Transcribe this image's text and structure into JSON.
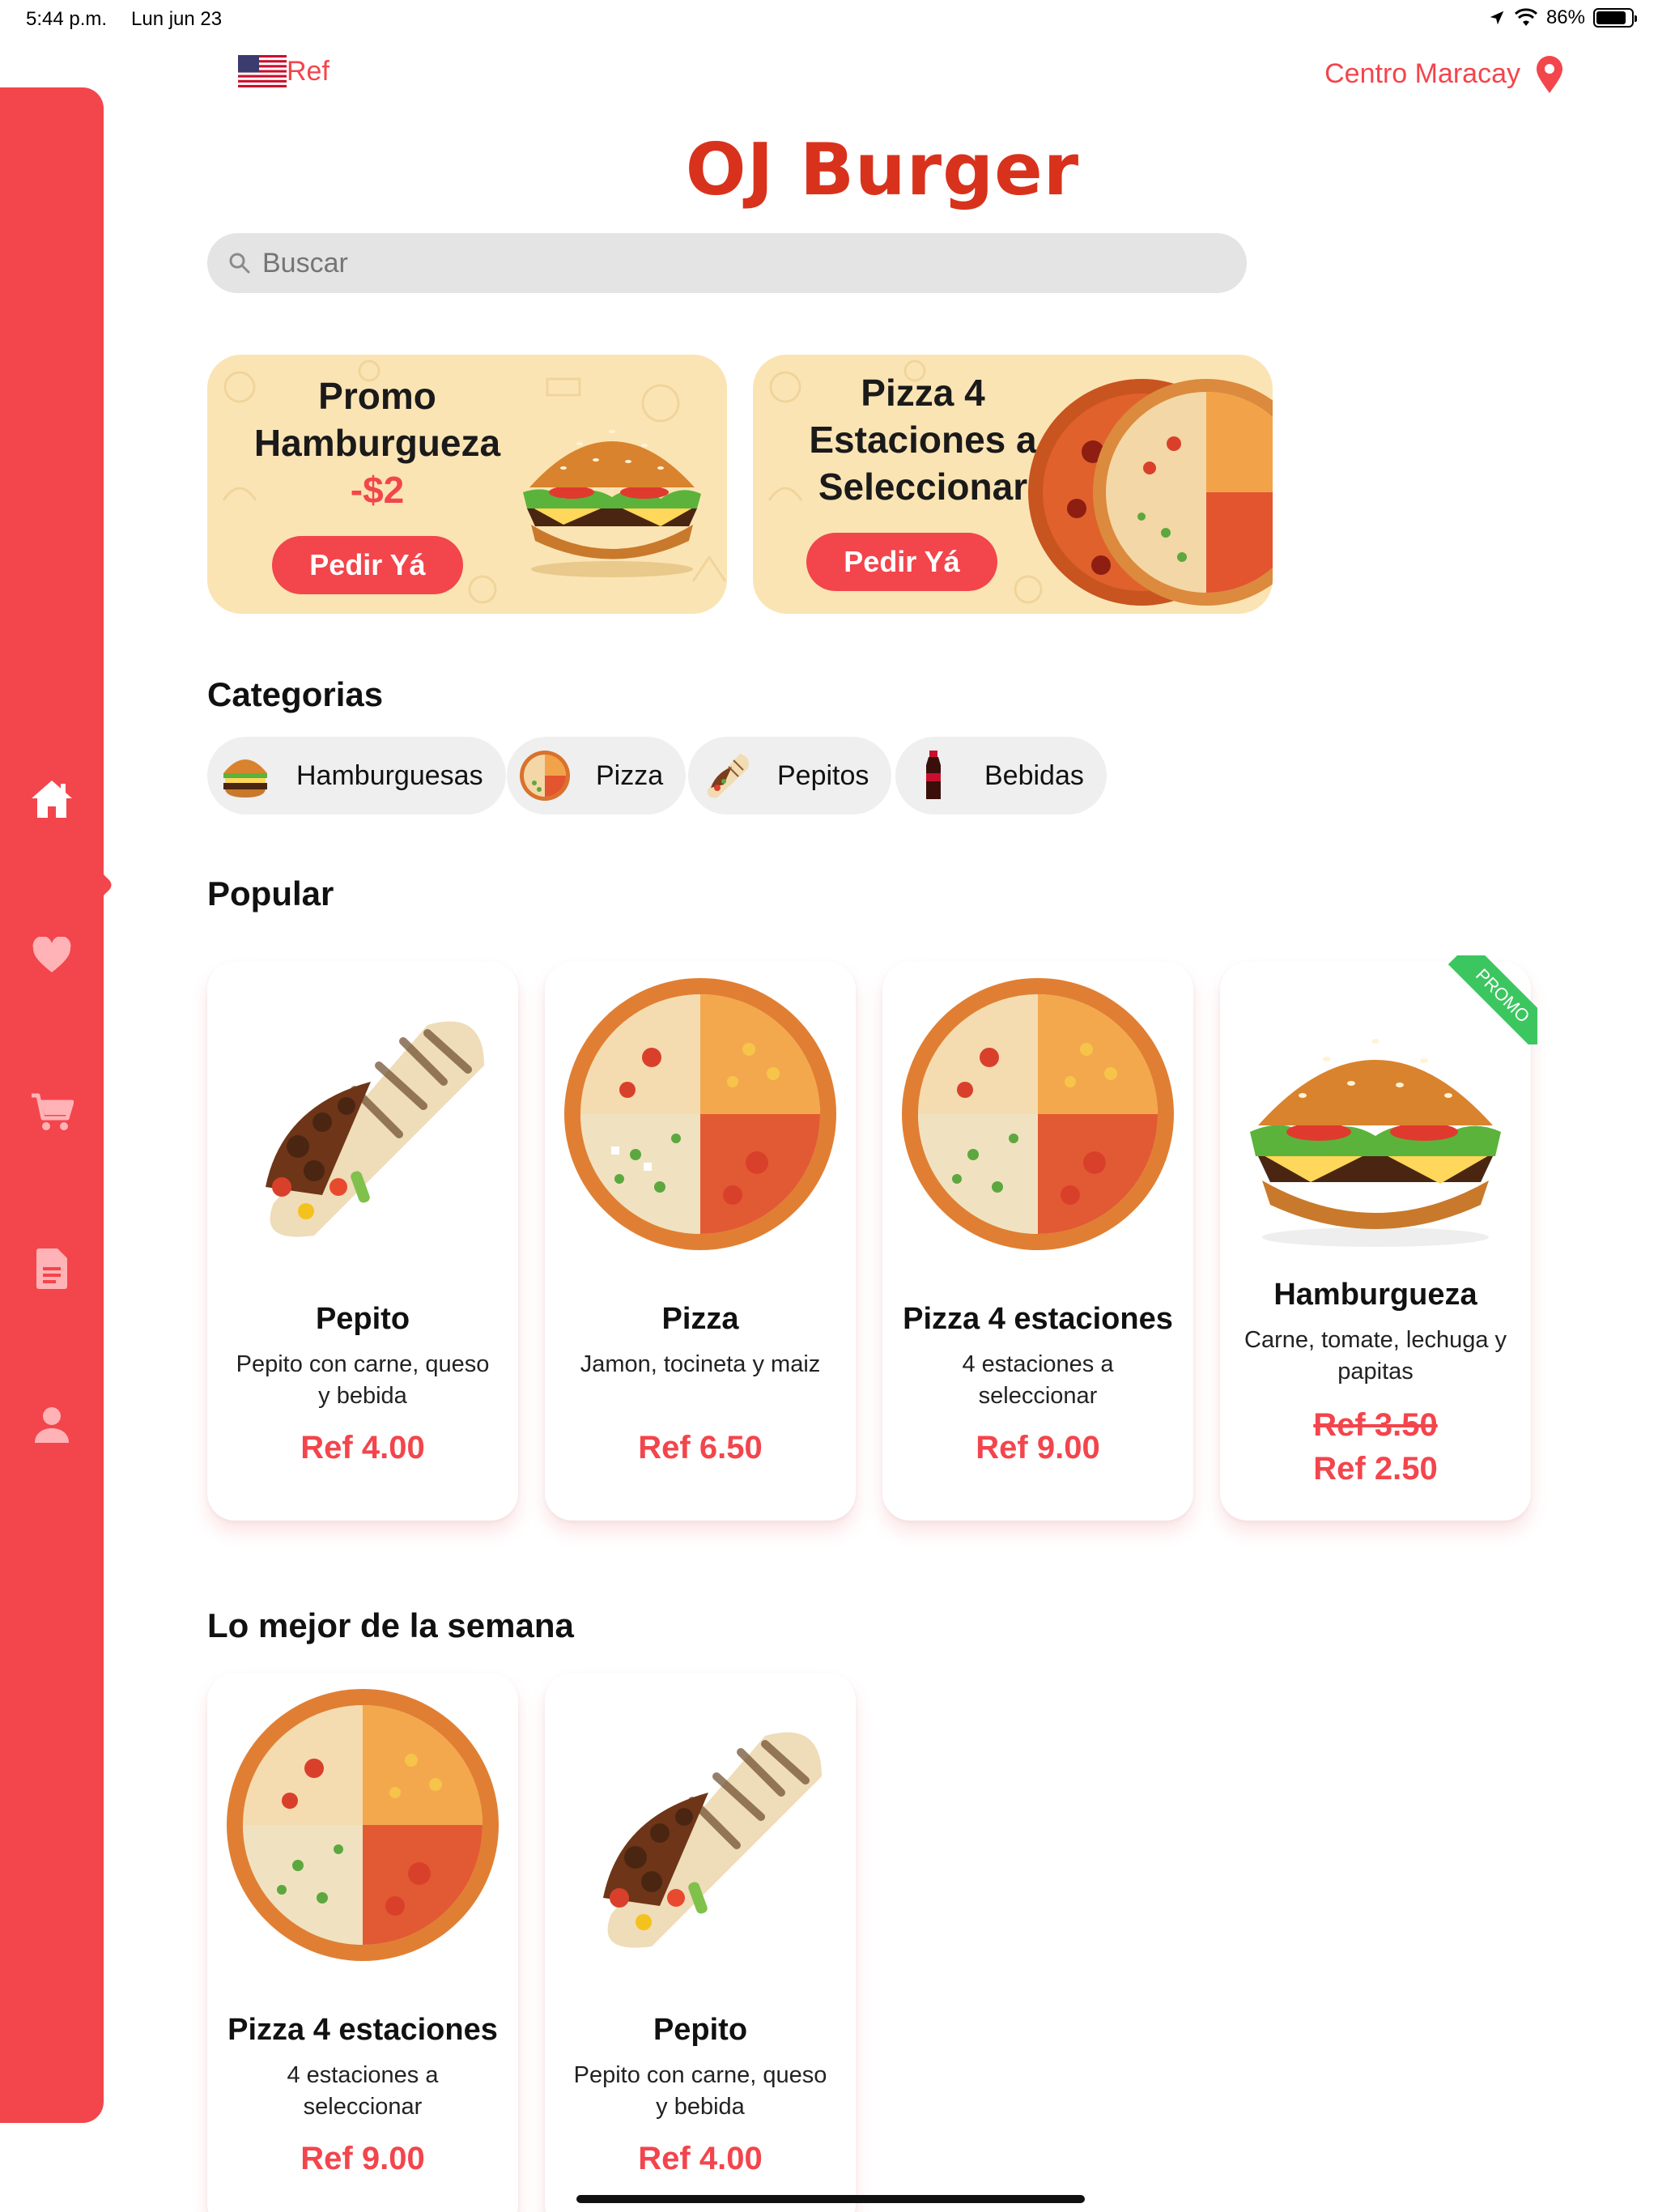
{
  "status_bar": {
    "time": "5:44 p.m.",
    "date": "Lun jun 23",
    "battery": "86%",
    "battery_level": 0.86
  },
  "header": {
    "currency_label": "Ref",
    "location_label": "Centro Maracay",
    "brand": "OJ Burger"
  },
  "search": {
    "placeholder": "Buscar"
  },
  "promos": [
    {
      "title_line1": "Promo",
      "title_line2": "Hamburgueza",
      "price": "-$2",
      "button": "Pedir Yá"
    },
    {
      "title_line1": "Pizza 4",
      "title_line2": "Estaciones a",
      "title_line3": "Seleccionar",
      "button": "Pedir Yá"
    }
  ],
  "sections": {
    "categories": "Categorias",
    "popular": "Popular",
    "best_week": "Lo mejor de la semana"
  },
  "categories": [
    {
      "label": "Hamburguesas",
      "icon": "burger-icon"
    },
    {
      "label": "Pizza",
      "icon": "pizza-icon"
    },
    {
      "label": "Pepitos",
      "icon": "wrap-icon"
    },
    {
      "label": "Bebidas",
      "icon": "soda-bottle-icon"
    }
  ],
  "popular": [
    {
      "title": "Pepito",
      "desc": "Pepito con carne, queso y bebida",
      "price": "Ref 4.00"
    },
    {
      "title": "Pizza",
      "desc": "Jamon, tocineta y maiz",
      "price": "Ref 6.50"
    },
    {
      "title": "Pizza 4 estaciones",
      "desc": "4 estaciones a seleccionar",
      "price": "Ref 9.00"
    },
    {
      "title": "Hamburgueza",
      "desc": "Carne, tomate, lechuga y papitas",
      "old_price": "Ref 3.50",
      "price": "Ref 2.50",
      "badge": "PROMO"
    }
  ],
  "best_week": [
    {
      "title": "Pizza 4 estaciones",
      "desc": "4 estaciones a seleccionar",
      "price": "Ref 9.00"
    },
    {
      "title": "Pepito",
      "desc": "Pepito con carne, queso y bebida",
      "price": "Ref 4.00"
    }
  ],
  "sidebar": {
    "items": [
      "home-icon",
      "heart-icon",
      "cart-icon",
      "document-icon",
      "user-icon"
    ],
    "active": "home-icon"
  },
  "colors": {
    "accent": "#f3454c",
    "brand": "#d8321d",
    "promo_bg": "#fbe4b4",
    "badge": "#3cc65f"
  }
}
